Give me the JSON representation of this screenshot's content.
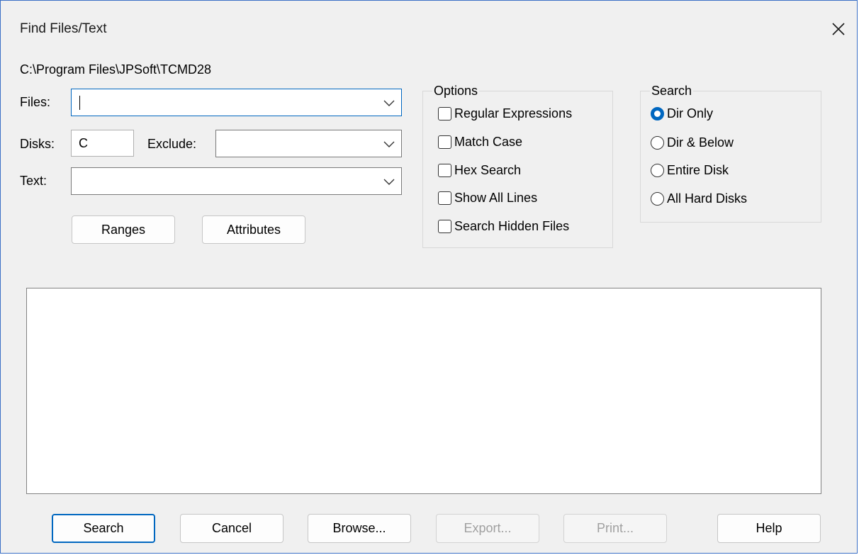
{
  "window": {
    "title": "Find Files/Text",
    "close_icon": "close-icon"
  },
  "current_path": "C:\\Program Files\\JPSoft\\TCMD28",
  "files": {
    "label": "Files:",
    "value": ""
  },
  "disks": {
    "label": "Disks:",
    "value": "C"
  },
  "exclude": {
    "label": "Exclude:",
    "value": ""
  },
  "text": {
    "label": "Text:",
    "value": ""
  },
  "buttons_top": {
    "ranges": "Ranges",
    "attributes": "Attributes"
  },
  "options": {
    "title": "Options",
    "items": [
      {
        "label": "Regular Expressions",
        "checked": false
      },
      {
        "label": "Match Case",
        "checked": false
      },
      {
        "label": "Hex Search",
        "checked": false
      },
      {
        "label": "Show All Lines",
        "checked": false
      },
      {
        "label": "Search Hidden Files",
        "checked": false
      }
    ]
  },
  "search": {
    "title": "Search",
    "items": [
      {
        "label": "Dir Only",
        "selected": true
      },
      {
        "label": "Dir & Below",
        "selected": false
      },
      {
        "label": "Entire Disk",
        "selected": false
      },
      {
        "label": "All Hard Disks",
        "selected": false
      }
    ]
  },
  "buttons_bottom": {
    "search": "Search",
    "cancel": "Cancel",
    "browse": "Browse...",
    "export": "Export...",
    "print": "Print...",
    "help": "Help"
  },
  "colors": {
    "accent": "#0067c0",
    "dialog_bg": "#f0f0f0",
    "disabled_text": "#a0a0a0"
  }
}
